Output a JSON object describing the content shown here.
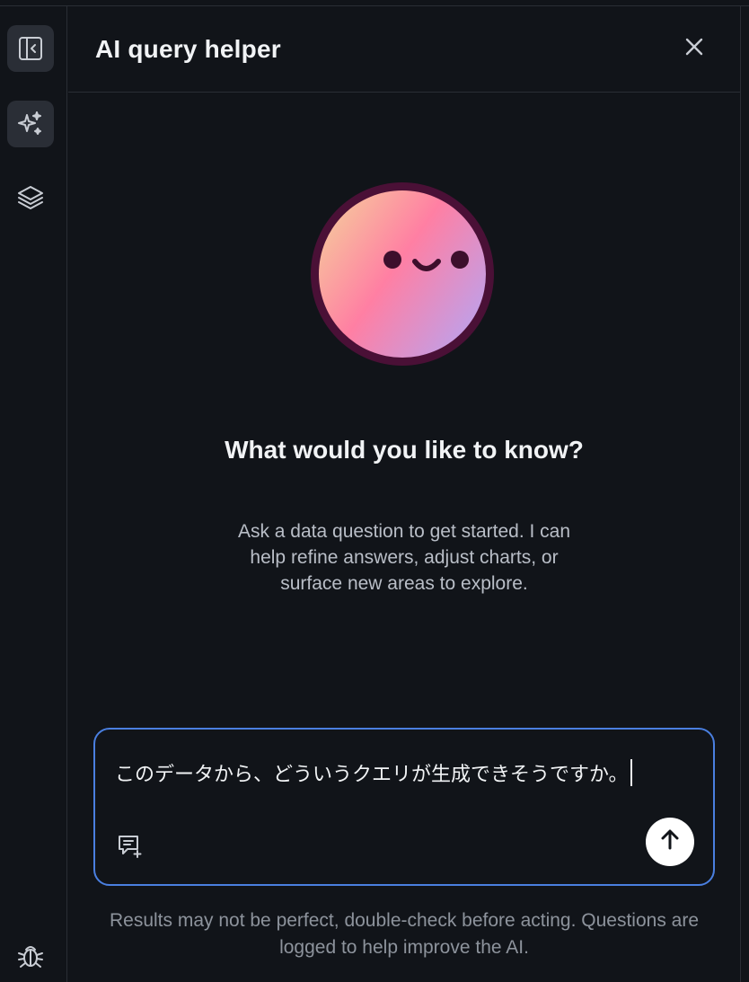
{
  "panel": {
    "title": "AI query helper"
  },
  "rail": {
    "items": [
      {
        "icon": "sidebar-collapse-icon",
        "active": true
      },
      {
        "icon": "sparkles-icon",
        "active": true
      },
      {
        "icon": "layers-icon",
        "active": false
      }
    ],
    "footer_icon": "bug-icon"
  },
  "empty_state": {
    "headline": "What would you like to know?",
    "description": "Ask a data question to get started. I can help refine answers, adjust charts, or surface new areas to explore."
  },
  "composer": {
    "value": "このデータから、どういうクエリが生成できそうですか。",
    "prompts_icon": "saved-prompts-icon",
    "send_icon": "arrow-up-icon"
  },
  "disclaimer": "Results may not be perfect, double-check before acting. Questions are logged to help improve the AI.",
  "colors": {
    "background": "#111419",
    "accent_border": "#4a7fe0",
    "avatar_ring": "#4a1036",
    "avatar_gradient": [
      "#f7c59a",
      "#ff7fa2",
      "#c3a0ec"
    ]
  }
}
